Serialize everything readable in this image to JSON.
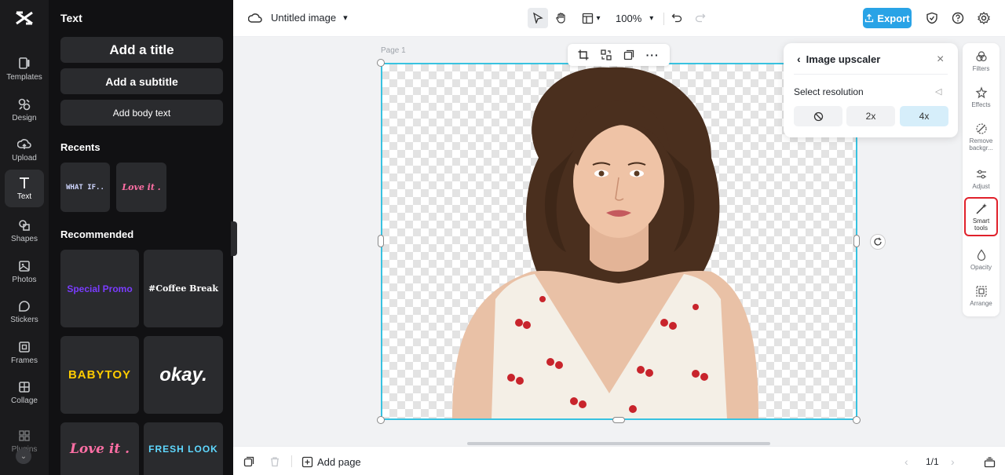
{
  "rail": {
    "items": [
      {
        "label": "Templates",
        "icon": "templates-icon"
      },
      {
        "label": "Design",
        "icon": "design-icon"
      },
      {
        "label": "Upload",
        "icon": "upload-icon"
      },
      {
        "label": "Text",
        "icon": "text-icon"
      },
      {
        "label": "Shapes",
        "icon": "shapes-icon"
      },
      {
        "label": "Photos",
        "icon": "photos-icon"
      },
      {
        "label": "Stickers",
        "icon": "stickers-icon"
      },
      {
        "label": "Frames",
        "icon": "frames-icon"
      },
      {
        "label": "Collage",
        "icon": "collage-icon"
      },
      {
        "label": "Plugins",
        "icon": "plugins-icon"
      }
    ],
    "active": "Text"
  },
  "panel": {
    "title": "Text",
    "add_title": "Add a title",
    "add_subtitle": "Add a subtitle",
    "add_body": "Add body text",
    "recents_label": "Recents",
    "recents": [
      "WHAT IF..",
      "Love it ."
    ],
    "recommended_label": "Recommended",
    "recommended": [
      "Special Promo",
      "#Coffee Break",
      "BABYTOY",
      "okay.",
      "Love it .",
      "FRESH LOOK"
    ]
  },
  "topbar": {
    "doc_title": "Untitled image",
    "zoom": "100%",
    "export_label": "Export"
  },
  "canvas": {
    "page_label": "Page 1"
  },
  "upscaler": {
    "title": "Image upscaler",
    "select_label": "Select resolution",
    "options": [
      "2x",
      "4x"
    ],
    "selected": "4x"
  },
  "right_tools": [
    {
      "label": "Filters",
      "icon": "filters-icon"
    },
    {
      "label": "Effects",
      "icon": "effects-icon"
    },
    {
      "label": "Remove backgr...",
      "icon": "remove-background-icon"
    },
    {
      "label": "Adjust",
      "icon": "adjust-icon"
    },
    {
      "label": "Smart tools",
      "icon": "smart-tools-icon"
    },
    {
      "label": "Opacity",
      "icon": "opacity-icon"
    },
    {
      "label": "Arrange",
      "icon": "arrange-icon"
    }
  ],
  "bottombar": {
    "add_page": "Add page",
    "page_count": "1/1"
  },
  "colors": {
    "accent": "#29a3e6",
    "selection": "#38c2e0",
    "highlight": "#e0212b"
  }
}
